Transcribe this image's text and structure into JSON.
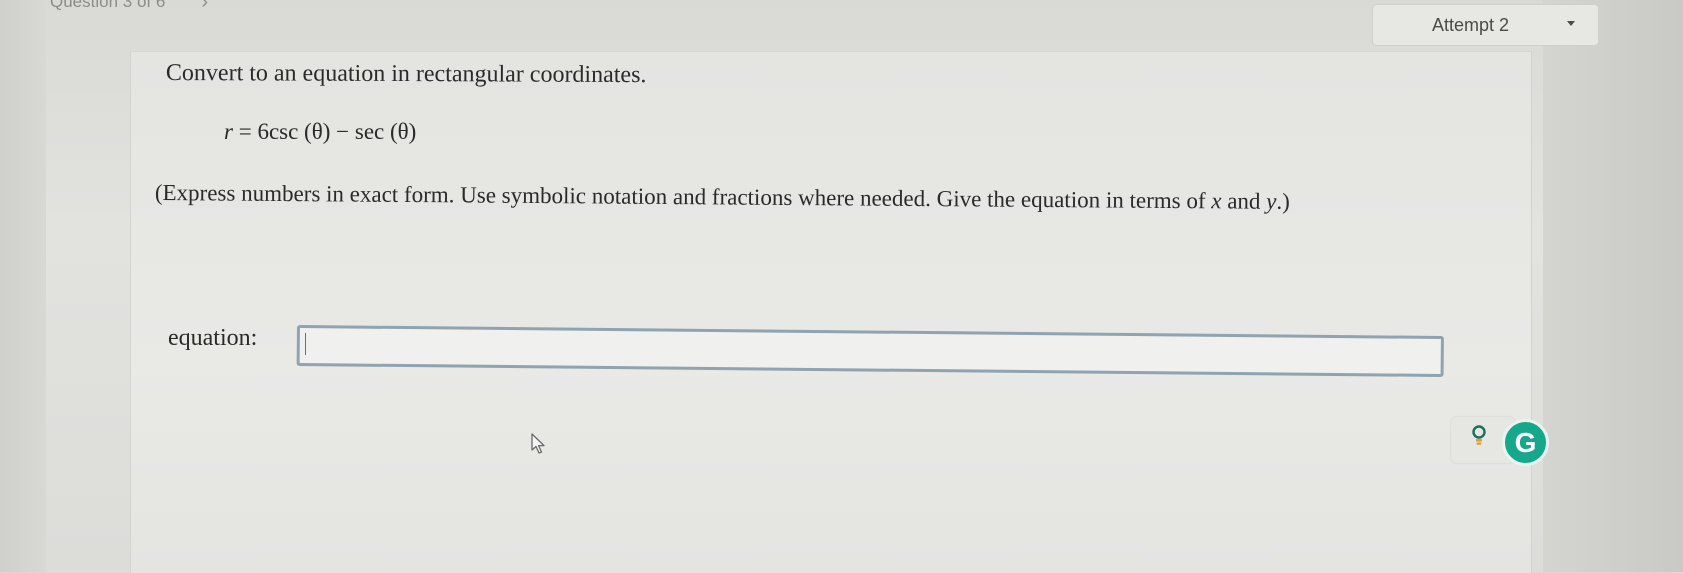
{
  "nav": {
    "question_counter": "Question 3 of 6",
    "next_arrow": "›",
    "next_icon": "chevron-right-icon"
  },
  "attempt": {
    "label": "Attempt 2",
    "caret_icon": "caret-down-icon"
  },
  "question": {
    "prompt": "Convert to an equation in rectangular coordinates.",
    "equation": {
      "lhs": "r",
      "equals": "=",
      "rhs_number": "6",
      "rhs_csc": "csc (θ)",
      "rhs_minus": "−",
      "rhs_sec": "sec (θ)"
    },
    "instructions": {
      "part1": "(Express numbers in exact form. Use symbolic notation and fractions where needed. Give the equation in terms of",
      "var_x": "x",
      "and": "and",
      "var_y": "y",
      "end": ".)"
    }
  },
  "answer": {
    "label": "equation:",
    "value": ""
  },
  "toolbar": {
    "hint_icon": "lightbulb-icon",
    "grammarly_letter": "G",
    "grammarly_color": "#15a88a"
  }
}
